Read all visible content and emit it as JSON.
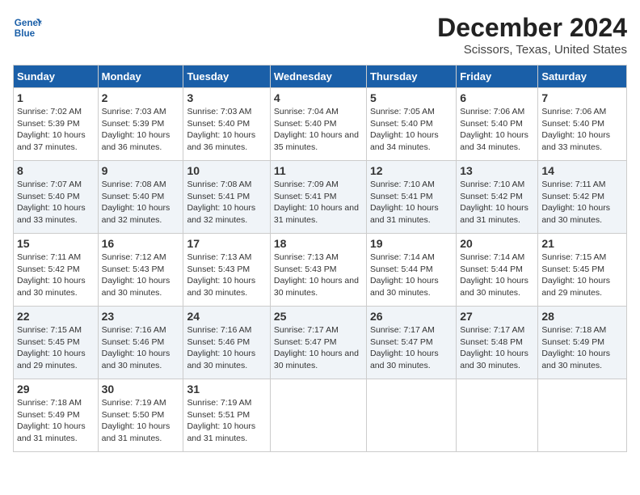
{
  "logo": {
    "line1": "General",
    "line2": "Blue"
  },
  "title": "December 2024",
  "subtitle": "Scissors, Texas, United States",
  "days_of_week": [
    "Sunday",
    "Monday",
    "Tuesday",
    "Wednesday",
    "Thursday",
    "Friday",
    "Saturday"
  ],
  "weeks": [
    [
      {
        "day": 1,
        "sunrise": "7:02 AM",
        "sunset": "5:39 PM",
        "daylight": "10 hours and 37 minutes."
      },
      {
        "day": 2,
        "sunrise": "7:03 AM",
        "sunset": "5:39 PM",
        "daylight": "10 hours and 36 minutes."
      },
      {
        "day": 3,
        "sunrise": "7:03 AM",
        "sunset": "5:40 PM",
        "daylight": "10 hours and 36 minutes."
      },
      {
        "day": 4,
        "sunrise": "7:04 AM",
        "sunset": "5:40 PM",
        "daylight": "10 hours and 35 minutes."
      },
      {
        "day": 5,
        "sunrise": "7:05 AM",
        "sunset": "5:40 PM",
        "daylight": "10 hours and 34 minutes."
      },
      {
        "day": 6,
        "sunrise": "7:06 AM",
        "sunset": "5:40 PM",
        "daylight": "10 hours and 34 minutes."
      },
      {
        "day": 7,
        "sunrise": "7:06 AM",
        "sunset": "5:40 PM",
        "daylight": "10 hours and 33 minutes."
      }
    ],
    [
      {
        "day": 8,
        "sunrise": "7:07 AM",
        "sunset": "5:40 PM",
        "daylight": "10 hours and 33 minutes."
      },
      {
        "day": 9,
        "sunrise": "7:08 AM",
        "sunset": "5:40 PM",
        "daylight": "10 hours and 32 minutes."
      },
      {
        "day": 10,
        "sunrise": "7:08 AM",
        "sunset": "5:41 PM",
        "daylight": "10 hours and 32 minutes."
      },
      {
        "day": 11,
        "sunrise": "7:09 AM",
        "sunset": "5:41 PM",
        "daylight": "10 hours and 31 minutes."
      },
      {
        "day": 12,
        "sunrise": "7:10 AM",
        "sunset": "5:41 PM",
        "daylight": "10 hours and 31 minutes."
      },
      {
        "day": 13,
        "sunrise": "7:10 AM",
        "sunset": "5:42 PM",
        "daylight": "10 hours and 31 minutes."
      },
      {
        "day": 14,
        "sunrise": "7:11 AM",
        "sunset": "5:42 PM",
        "daylight": "10 hours and 30 minutes."
      }
    ],
    [
      {
        "day": 15,
        "sunrise": "7:11 AM",
        "sunset": "5:42 PM",
        "daylight": "10 hours and 30 minutes."
      },
      {
        "day": 16,
        "sunrise": "7:12 AM",
        "sunset": "5:43 PM",
        "daylight": "10 hours and 30 minutes."
      },
      {
        "day": 17,
        "sunrise": "7:13 AM",
        "sunset": "5:43 PM",
        "daylight": "10 hours and 30 minutes."
      },
      {
        "day": 18,
        "sunrise": "7:13 AM",
        "sunset": "5:43 PM",
        "daylight": "10 hours and 30 minutes."
      },
      {
        "day": 19,
        "sunrise": "7:14 AM",
        "sunset": "5:44 PM",
        "daylight": "10 hours and 30 minutes."
      },
      {
        "day": 20,
        "sunrise": "7:14 AM",
        "sunset": "5:44 PM",
        "daylight": "10 hours and 30 minutes."
      },
      {
        "day": 21,
        "sunrise": "7:15 AM",
        "sunset": "5:45 PM",
        "daylight": "10 hours and 29 minutes."
      }
    ],
    [
      {
        "day": 22,
        "sunrise": "7:15 AM",
        "sunset": "5:45 PM",
        "daylight": "10 hours and 29 minutes."
      },
      {
        "day": 23,
        "sunrise": "7:16 AM",
        "sunset": "5:46 PM",
        "daylight": "10 hours and 30 minutes."
      },
      {
        "day": 24,
        "sunrise": "7:16 AM",
        "sunset": "5:46 PM",
        "daylight": "10 hours and 30 minutes."
      },
      {
        "day": 25,
        "sunrise": "7:17 AM",
        "sunset": "5:47 PM",
        "daylight": "10 hours and 30 minutes."
      },
      {
        "day": 26,
        "sunrise": "7:17 AM",
        "sunset": "5:47 PM",
        "daylight": "10 hours and 30 minutes."
      },
      {
        "day": 27,
        "sunrise": "7:17 AM",
        "sunset": "5:48 PM",
        "daylight": "10 hours and 30 minutes."
      },
      {
        "day": 28,
        "sunrise": "7:18 AM",
        "sunset": "5:49 PM",
        "daylight": "10 hours and 30 minutes."
      }
    ],
    [
      {
        "day": 29,
        "sunrise": "7:18 AM",
        "sunset": "5:49 PM",
        "daylight": "10 hours and 31 minutes."
      },
      {
        "day": 30,
        "sunrise": "7:19 AM",
        "sunset": "5:50 PM",
        "daylight": "10 hours and 31 minutes."
      },
      {
        "day": 31,
        "sunrise": "7:19 AM",
        "sunset": "5:51 PM",
        "daylight": "10 hours and 31 minutes."
      },
      null,
      null,
      null,
      null
    ]
  ]
}
